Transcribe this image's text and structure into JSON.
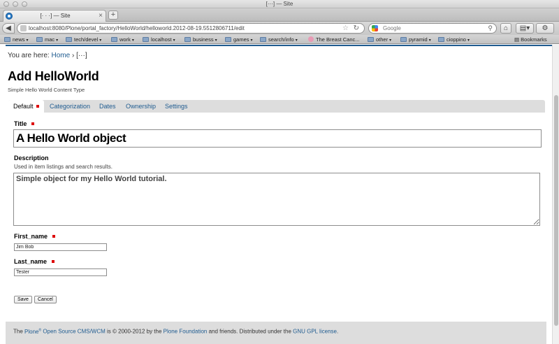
{
  "window": {
    "title": "[···] — Site"
  },
  "tab": {
    "title": "[· · ·] — Site",
    "close": "×",
    "new_tab": "+"
  },
  "nav": {
    "back": "◀",
    "url": "localhost:8080/Plone/portal_factory/HelloWorld/helloworld.2012-08-19.5512806711/edit",
    "star": "☆",
    "reload": "↻",
    "search_engine": "Google",
    "search_placeholder": "Google",
    "home": "⌂",
    "tools": "⚙"
  },
  "bookmarks": {
    "items": [
      {
        "label": "news",
        "type": "folder"
      },
      {
        "label": "mac",
        "type": "folder"
      },
      {
        "label": "tech/devel",
        "type": "folder"
      },
      {
        "label": "work",
        "type": "folder"
      },
      {
        "label": "localhost",
        "type": "folder"
      },
      {
        "label": "business",
        "type": "folder"
      },
      {
        "label": "games",
        "type": "folder"
      },
      {
        "label": "search/info",
        "type": "folder"
      },
      {
        "label": "The Breast Canc...",
        "type": "link"
      },
      {
        "label": "other",
        "type": "folder"
      },
      {
        "label": "pyramid",
        "type": "folder"
      },
      {
        "label": "cioppino",
        "type": "folder"
      }
    ],
    "menu": "Bookmarks"
  },
  "breadcrumbs": {
    "prefix": "You are here:",
    "home": "Home",
    "separator": "›",
    "current": "[···]"
  },
  "page": {
    "heading": "Add HelloWorld",
    "description": "Simple Hello World Content Type"
  },
  "form_tabs": [
    {
      "label": "Default",
      "selected": true,
      "required": true
    },
    {
      "label": "Categorization",
      "selected": false
    },
    {
      "label": "Dates",
      "selected": false
    },
    {
      "label": "Ownership",
      "selected": false
    },
    {
      "label": "Settings",
      "selected": false
    }
  ],
  "fields": {
    "title": {
      "label": "Title",
      "value": "A Hello World object",
      "required": true
    },
    "description": {
      "label": "Description",
      "help": "Used in item listings and search results.",
      "value": "Simple object for my Hello World tutorial."
    },
    "first_name": {
      "label": "First_name",
      "value": "Jim Bob",
      "required": true
    },
    "last_name": {
      "label": "Last_name",
      "value": "Tester",
      "required": true
    }
  },
  "buttons": {
    "save": "Save",
    "cancel": "Cancel"
  },
  "footer": {
    "the": "The",
    "plone": "Plone",
    "reg": "®",
    "oss": "Open Source CMS/WCM",
    "is": "is © 2000-2012 by the",
    "foundation": "Plone Foundation",
    "friends": "and friends. Distributed under the",
    "license": "GNU GPL license",
    "end": "."
  },
  "colors": {
    "link": "#205c90",
    "required_marker": "#dd0000",
    "tab_bar": "#dddddd"
  }
}
